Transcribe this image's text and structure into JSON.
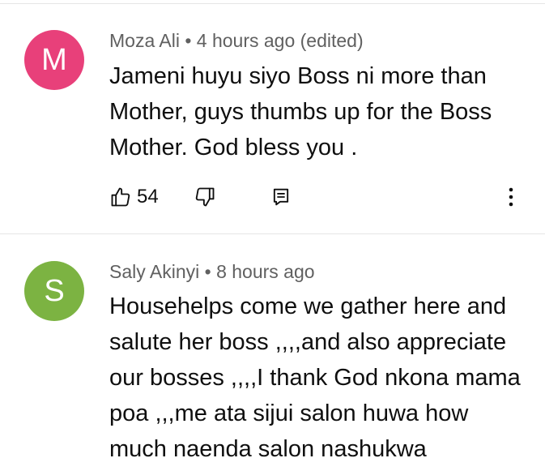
{
  "comments": [
    {
      "avatar_letter": "M",
      "avatar_color": "#e8407a",
      "author": "Moza Ali",
      "separator": "•",
      "time": "4 hours ago (edited)",
      "text": "Jameni huyu siyo Boss ni more than Mother, guys thumbs up for the Boss Mother.  God bless you .",
      "likes": "54"
    },
    {
      "avatar_letter": "S",
      "avatar_color": "#7cb342",
      "author": "Saly Akinyi",
      "separator": "•",
      "time": "8 hours ago",
      "text": "Househelps come we gather here and salute her boss ,,,,and also appreciate our bosses ,,,,I thank God nkona mama poa ,,,me ata sijui salon huwa how much naenda salon nashukwa"
    }
  ]
}
